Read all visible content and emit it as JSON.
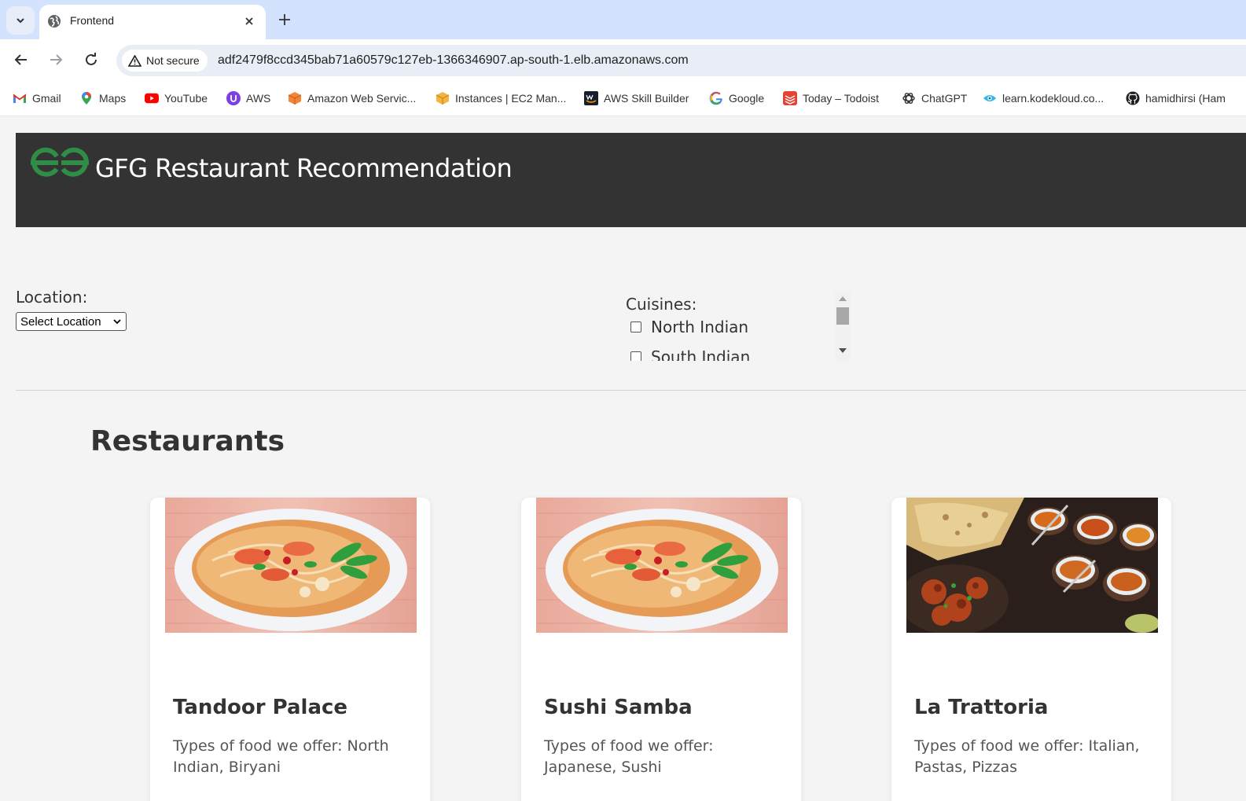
{
  "browser": {
    "tab": {
      "title": "Frontend"
    },
    "toolbar": {
      "security_label": "Not secure",
      "url": "adf2479f8ccd345bab71a60579c127eb-1366346907.ap-south-1.elb.amazonaws.com"
    },
    "bookmarks": [
      {
        "label": "Gmail",
        "icon": "gmail-icon"
      },
      {
        "label": "Maps",
        "icon": "maps-icon"
      },
      {
        "label": "YouTube",
        "icon": "youtube-icon"
      },
      {
        "label": "AWS",
        "icon": "aws-icon"
      },
      {
        "label": "Amazon Web Servic...",
        "icon": "aws-cube-icon"
      },
      {
        "label": "Instances | EC2 Man...",
        "icon": "ec2-icon"
      },
      {
        "label": "AWS Skill Builder",
        "icon": "aws-skill-builder-icon"
      },
      {
        "label": "Google",
        "icon": "google-icon"
      },
      {
        "label": "Today – Todoist",
        "icon": "todoist-icon"
      },
      {
        "label": "ChatGPT",
        "icon": "chatgpt-icon"
      },
      {
        "label": "learn.kodekloud.co...",
        "icon": "kodekloud-icon"
      },
      {
        "label": "hamidhirsi (Ham",
        "icon": "github-icon"
      }
    ]
  },
  "app": {
    "header_title": "GFG Restaurant Recommendation",
    "location_label": "Location:",
    "location_select": "Select Location",
    "cuisines_label": "Cuisines:",
    "cuisines": [
      {
        "label": "North Indian",
        "checked": false
      },
      {
        "label": "South Indian",
        "checked": false
      }
    ],
    "restaurants_title": "Restaurants",
    "restaurants": [
      {
        "name": "Tandoor Palace",
        "description": "Types of food we offer: North Indian, Biryani",
        "image": "noodle-soup-image"
      },
      {
        "name": "Sushi Samba",
        "description": "Types of food we offer: Japanese, Sushi",
        "image": "noodle-soup-image"
      },
      {
        "name": "La Trattoria",
        "description": "Types of food we offer: Italian, Pastas, Pizzas",
        "image": "indian-platter-image"
      }
    ]
  },
  "colors": {
    "header_bg": "#333333",
    "brand_green": "#2f8d46",
    "tabstrip_bg": "#d3e3fd",
    "page_bg": "#f4f4f4"
  }
}
